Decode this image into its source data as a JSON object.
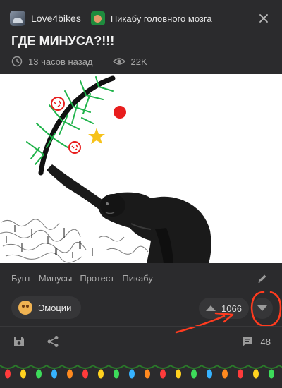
{
  "header": {
    "author": "Love4bikes",
    "community": "Пикабу головного мозга",
    "avatar_icon": "user-avatar",
    "community_icon": "brain-icon",
    "more_icon": "more-vertical-icon"
  },
  "post": {
    "title": "ГДЕ МИНУСА?!!!",
    "time": "13 часов назад",
    "views": "22K",
    "image": "black-and-white drawing of a monkey holding a stick decorated with a drawn Christmas garland, ornaments and a star"
  },
  "tags": [
    "Бунт",
    "Минусы",
    "Протест",
    "Пикабу"
  ],
  "actions": {
    "emotions_label": "Эмоции",
    "rating": "1066",
    "comments_count": "48"
  },
  "colors": {
    "background": "#2b2b2d",
    "pill": "#363638",
    "annotation": "#ff3b1f",
    "tree_green": "#1fb34a",
    "ornament_red": "#e81d1d",
    "star": "#f6c21a"
  }
}
